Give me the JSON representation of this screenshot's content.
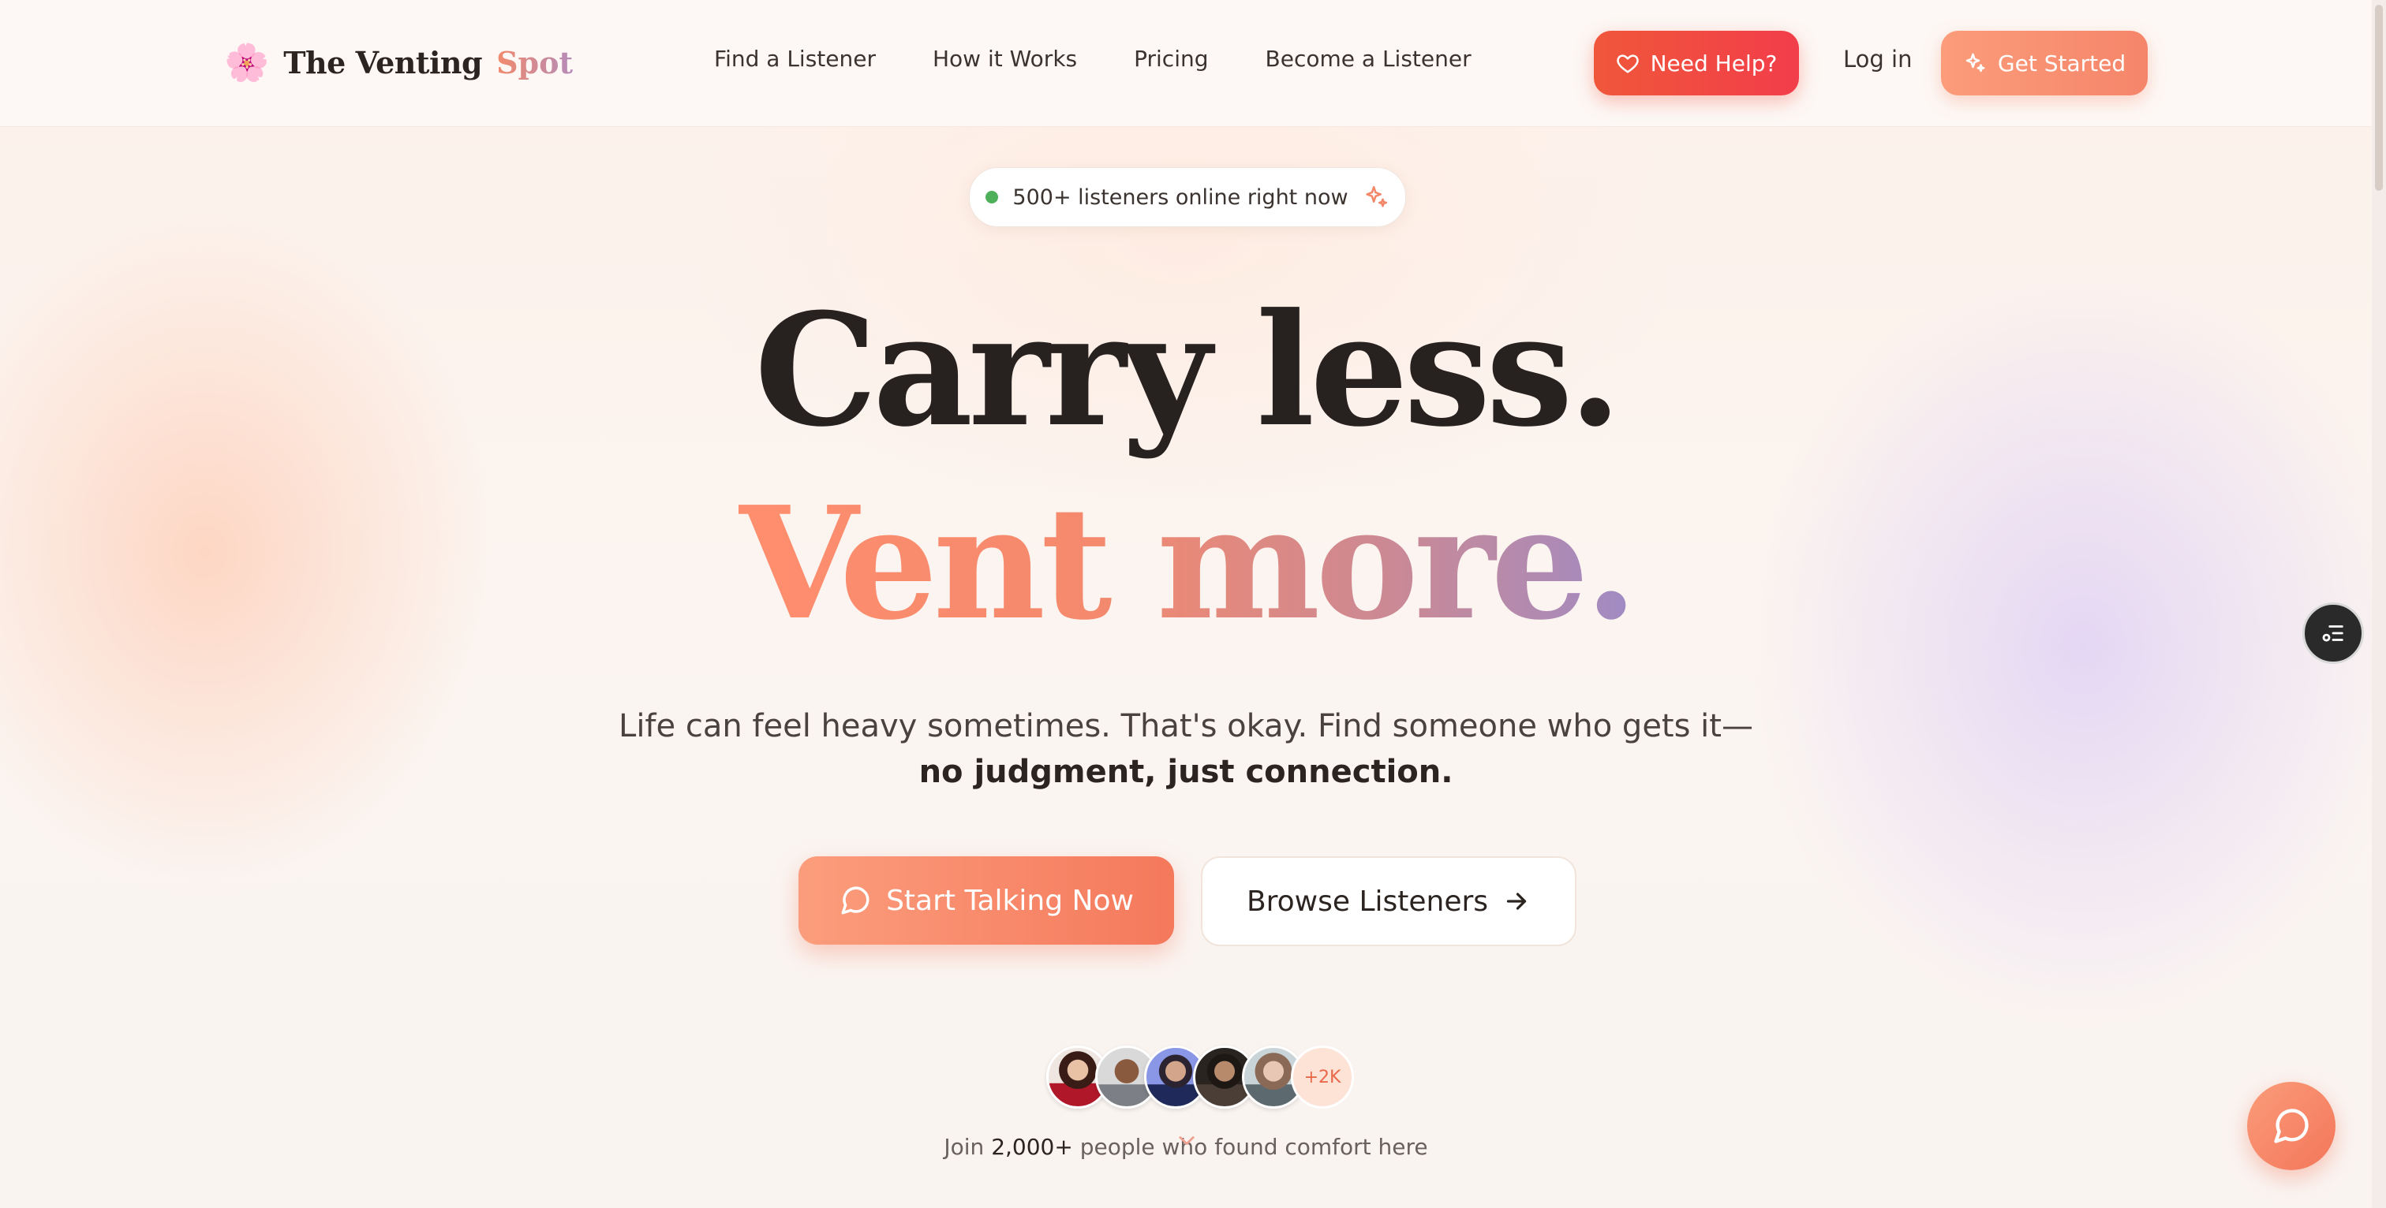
{
  "brand": {
    "emoji": "🌸",
    "name_main": "The Venting",
    "name_accent": "Spot"
  },
  "nav": {
    "items": [
      "Find a Listener",
      "How it Works",
      "Pricing",
      "Become a Listener"
    ]
  },
  "header": {
    "help_label": "Need Help?",
    "login_label": "Log in",
    "get_started_label": "Get Started"
  },
  "status_pill": {
    "text": "500+ listeners online right now",
    "dot_color": "#4fb05c"
  },
  "hero": {
    "line1": "Carry less.",
    "line2": "Vent more.",
    "subtitle_plain": "Life can feel heavy sometimes. That's okay. Find someone who gets it—",
    "subtitle_bold": "no judgment, just connection.",
    "cta_primary": "Start Talking Now",
    "cta_secondary": "Browse Listeners"
  },
  "social_proof": {
    "more_badge": "+2K",
    "join_prefix": "Join",
    "join_count": "2,000+",
    "join_suffix": "people who found comfort here"
  },
  "colors": {
    "accent": "#f5856a",
    "help_red": "#f0473f",
    "gradient_start": "#ff8e6e",
    "gradient_end": "#a08bc4"
  },
  "icons": [
    "heart-icon",
    "sparkle-icon",
    "chat-bubble-icon",
    "arrow-right-icon",
    "chevron-down-icon",
    "menu-list-icon"
  ]
}
